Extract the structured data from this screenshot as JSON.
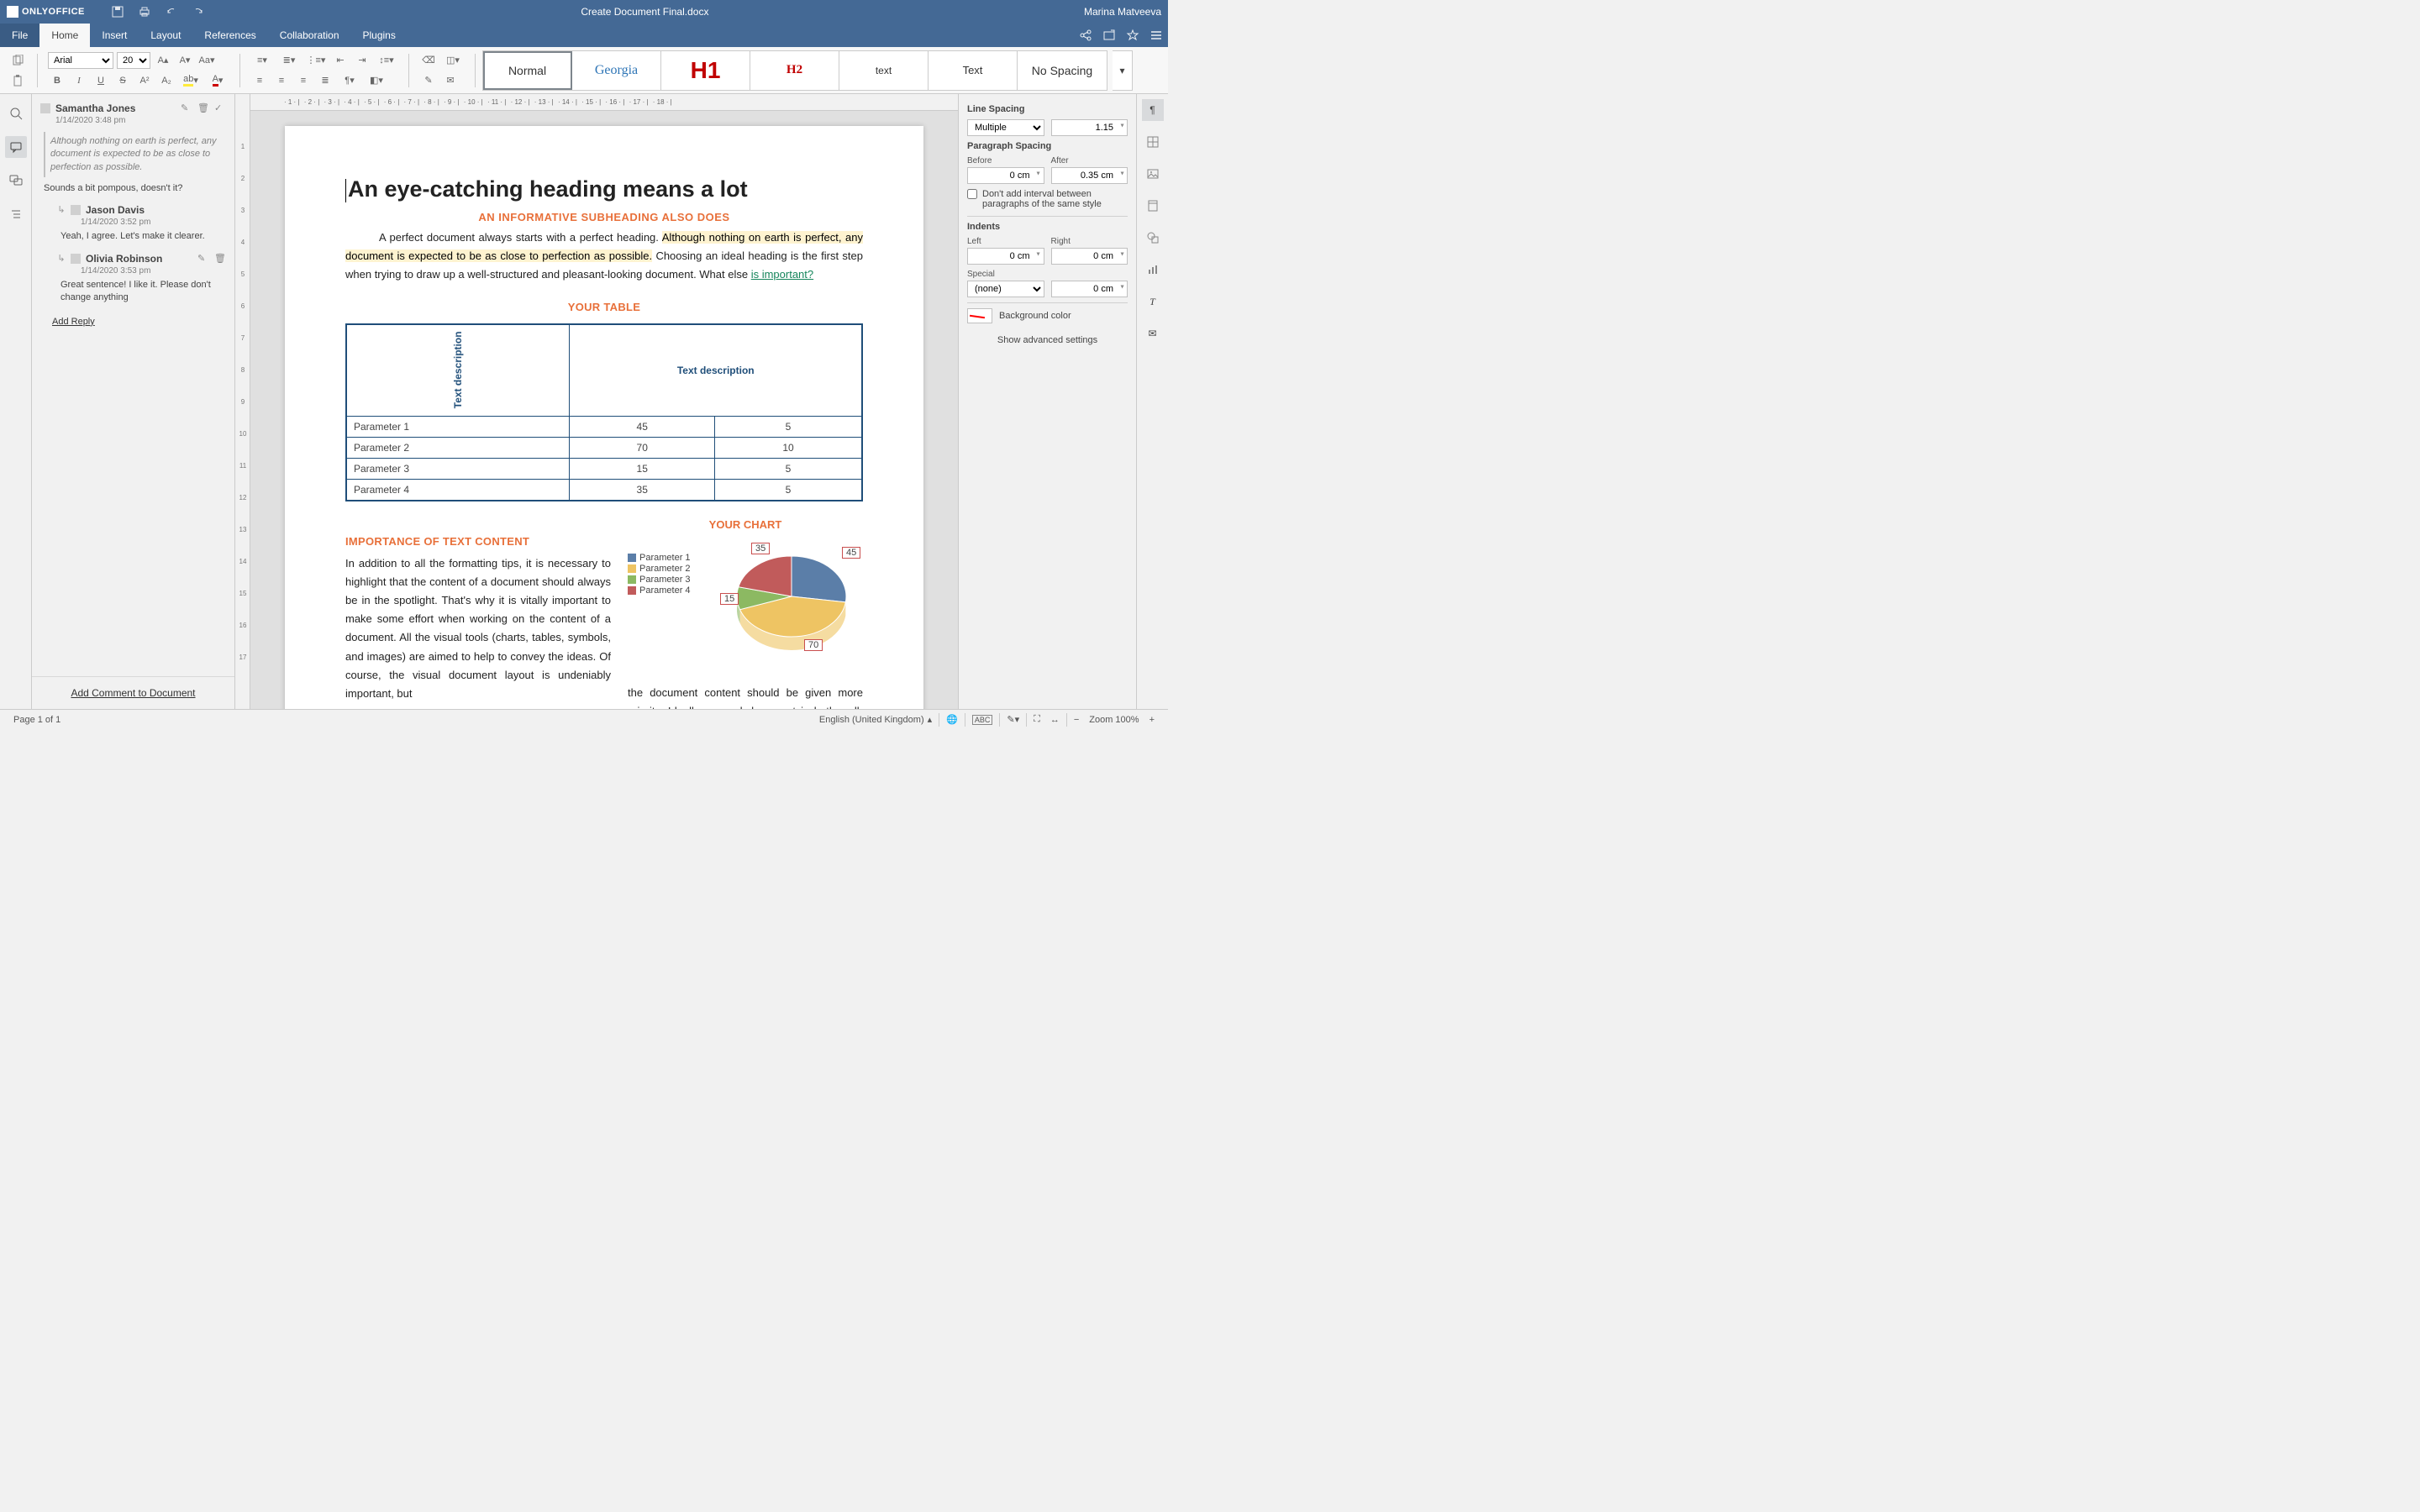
{
  "title_bar": {
    "app_name": "ONLYOFFICE",
    "document_title": "Create Document Final.docx",
    "username": "Marina Matveeva"
  },
  "menu_tabs": {
    "file": "File",
    "home": "Home",
    "insert": "Insert",
    "layout": "Layout",
    "references": "References",
    "collaboration": "Collaboration",
    "plugins": "Plugins"
  },
  "ribbon": {
    "font_name": "Arial",
    "font_size": "20",
    "styles": [
      {
        "label": "Normal",
        "css": "font-family:Arial;font-size:14px;color:#333;"
      },
      {
        "label": "Georgia",
        "css": "font-family:Georgia;color:#2e75b6;font-size:16px;"
      },
      {
        "label": "H1",
        "css": "font-family:Arial;color:#c00000;font-weight:900;font-size:28px;"
      },
      {
        "label": "H2",
        "css": "font-family:Georgia;color:#c00000;font-weight:bold;font-size:15px;"
      },
      {
        "label": "text",
        "css": "font-family:Arial;font-size:12px;color:#333;"
      },
      {
        "label": "Text",
        "css": "font-family:Arial;font-size:13px;color:#333;"
      },
      {
        "label": "No Spacing",
        "css": "font-family:Arial;font-size:14px;color:#333;"
      }
    ]
  },
  "comments": {
    "thread": {
      "author": "Samantha Jones",
      "date": "1/14/2020 3:48 pm",
      "quote": "Although nothing on earth is perfect, any document is expected to be as close to perfection as possible.",
      "text": "Sounds a bit pompous, doesn't it?",
      "replies": [
        {
          "author": "Jason Davis",
          "date": "1/14/2020 3:52 pm",
          "text": "Yeah, I agree. Let's make it clearer."
        },
        {
          "author": "Olivia Robinson",
          "date": "1/14/2020 3:53 pm",
          "text": "Great sentence! I like it. Please don't change anything"
        }
      ]
    },
    "add_reply": "Add Reply",
    "add_comment": "Add Comment to Document"
  },
  "document": {
    "heading": "An eye-catching heading means a lot",
    "subheading": "AN INFORMATIVE SUBHEADING ALSO DOES",
    "para1_pre": "A perfect document always starts with a perfect heading. ",
    "para1_mark": "Although nothing on earth is perfect, any document is expected to be as close to perfection as possible.",
    "para1_mid": " Choosing an ideal heading is the first step when trying to draw up a well-structured and pleasant-looking document. What else  ",
    "para1_link": "is important?",
    "table_section": "YOUR TABLE",
    "table": {
      "col_header": "Text description",
      "row_header": "Text description",
      "rows": [
        {
          "p": "Parameter 1",
          "a": "45",
          "b": "5"
        },
        {
          "p": "Parameter 2",
          "a": "70",
          "b": "10"
        },
        {
          "p": "Parameter 3",
          "a": "15",
          "b": "5"
        },
        {
          "p": "Parameter 4",
          "a": "35",
          "b": "5"
        }
      ]
    },
    "importance_title": "IMPORTANCE OF TEXT CONTENT",
    "importance_text_left": "In addition to all the formatting tips, it is necessary to highlight that the content of a document should always be in the spotlight. That's why it is vitally important to make some effort when working on the content of a document. All the visual tools (charts, tables, symbols, and images) are aimed to help to convey the ideas. Of course, the visual document layout is undeniably important, but",
    "importance_text_right": "the document content should be given more priority. Ideally, a good document is both well-designed and easy to read and understand.",
    "chart_title": "YOUR CHART"
  },
  "chart_data": {
    "type": "pie",
    "title": "YOUR CHART",
    "series": [
      {
        "name": "Parameter 1",
        "value": 45,
        "color": "#5b7ea8"
      },
      {
        "name": "Parameter 2",
        "value": 70,
        "color": "#eec463"
      },
      {
        "name": "Parameter 3",
        "value": 15,
        "color": "#8cb962"
      },
      {
        "name": "Parameter 4",
        "value": 35,
        "color": "#c15b5b"
      }
    ]
  },
  "right_panel": {
    "line_spacing": "Line Spacing",
    "line_spacing_type": "Multiple",
    "line_spacing_value": "1.15",
    "para_spacing": "Paragraph Spacing",
    "before": "Before",
    "before_val": "0 cm",
    "after": "After",
    "after_val": "0.35 cm",
    "no_interval": "Don't add interval between paragraphs of the same style",
    "indents": "Indents",
    "left": "Left",
    "left_val": "0 cm",
    "right": "Right",
    "right_val": "0 cm",
    "special": "Special",
    "special_type": "(none)",
    "special_val": "0 cm",
    "bgcolor": "Background color",
    "advanced": "Show advanced settings"
  },
  "status_bar": {
    "page": "Page 1 of 1",
    "language": "English (United Kingdom)",
    "zoom": "Zoom 100%"
  }
}
